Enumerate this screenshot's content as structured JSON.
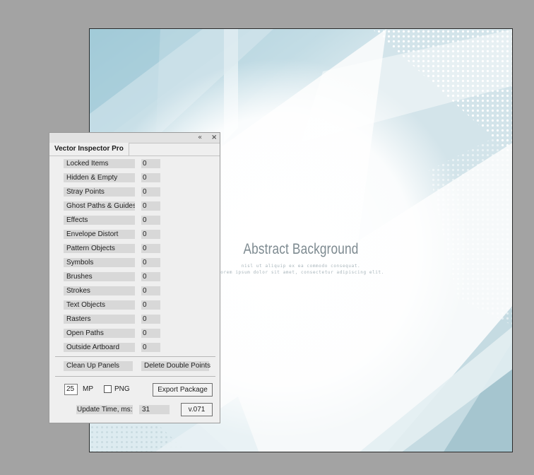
{
  "artboard": {
    "title": "Abstract Background",
    "subtitle_line1": "nisl ut aliquip ex ea commodo consequat.",
    "subtitle_line2": "Lorem ipsum dolor sit amet, consectetur adipiscing elit.",
    "accent_color": "#7fb4c5"
  },
  "panel": {
    "title": "Vector Inspector Pro",
    "collapse_icon": "«",
    "close_icon": "×",
    "rows": [
      {
        "label": "Locked Items",
        "value": "0"
      },
      {
        "label": "Hidden & Empty",
        "value": "0"
      },
      {
        "label": "Stray Points",
        "value": "0"
      },
      {
        "label": "Ghost Paths & Guides",
        "value": "0"
      },
      {
        "label": "Effects",
        "value": "0"
      },
      {
        "label": "Envelope Distort",
        "value": "0"
      },
      {
        "label": "Pattern Objects",
        "value": "0"
      },
      {
        "label": "Symbols",
        "value": "0"
      },
      {
        "label": "Brushes",
        "value": "0"
      },
      {
        "label": "Strokes",
        "value": "0"
      },
      {
        "label": "Text Objects",
        "value": "0"
      },
      {
        "label": "Rasters",
        "value": "0"
      },
      {
        "label": "Open Paths",
        "value": "0"
      },
      {
        "label": "Outside Artboard",
        "value": "0"
      }
    ],
    "clean_up_label": "Clean Up Panels",
    "delete_double_label": "Delete Double Points",
    "mp_value": "25",
    "mp_label": "MP",
    "png_label": "PNG",
    "png_checked": false,
    "export_label": "Export Package",
    "update_time_label": "Update Time, ms:",
    "update_time_value": "31",
    "version_label": "v.071"
  }
}
